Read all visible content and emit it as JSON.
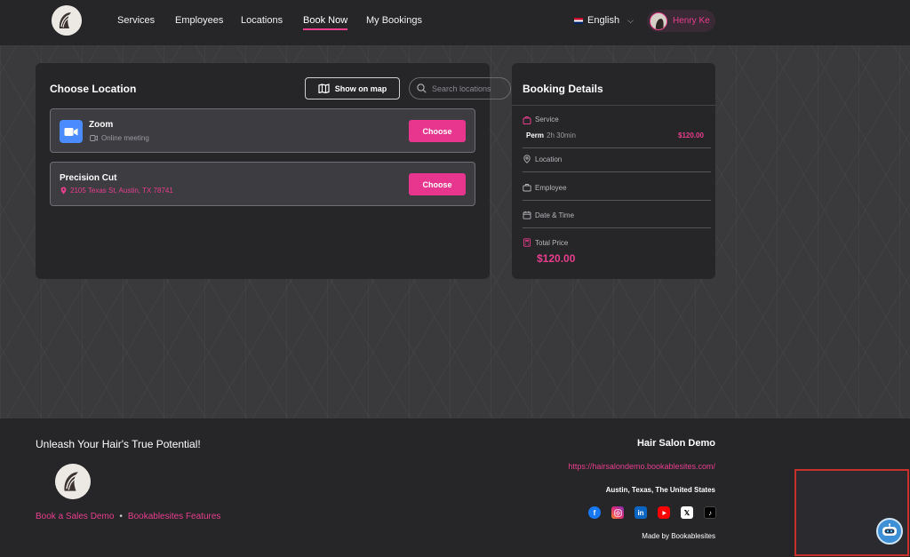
{
  "nav": {
    "links": [
      "Services",
      "Employees",
      "Locations",
      "Book Now",
      "My Bookings"
    ],
    "language": "English",
    "user": "Henry Ke"
  },
  "locations": {
    "title": "Choose Location",
    "show_map": "Show on map",
    "search_placeholder": "Search locations",
    "items": [
      {
        "name": "Zoom",
        "sub": "Online meeting",
        "button": "Choose"
      },
      {
        "name": "Precision Cut",
        "sub": "2105 Texas St, Austin, TX 78741",
        "button": "Choose"
      }
    ]
  },
  "booking": {
    "title": "Booking Details",
    "service_label": "Service",
    "service_name": "Perm",
    "service_duration": "2h 30min",
    "service_price": "$120.00",
    "location_label": "Location",
    "employee_label": "Employee",
    "datetime_label": "Date & Time",
    "total_label": "Total Price",
    "total": "$120.00"
  },
  "footer": {
    "tagline": "Unleash Your Hair's True Potential!",
    "link1": "Book a Sales Demo",
    "link2": "Bookablesites Features",
    "site_name": "Hair Salon Demo",
    "site_url": "https://hairsalondemo.bookablesites.com/",
    "address": "Austin, Texas, The United States",
    "made_by": "Made by Bookablesites",
    "socials": [
      "facebook-icon",
      "instagram-icon",
      "linkedin-icon",
      "youtube-icon",
      "x-icon",
      "tiktok-icon"
    ]
  },
  "colors": {
    "accent": "#e8368f",
    "card": "#262629",
    "background": "#3a393b"
  }
}
